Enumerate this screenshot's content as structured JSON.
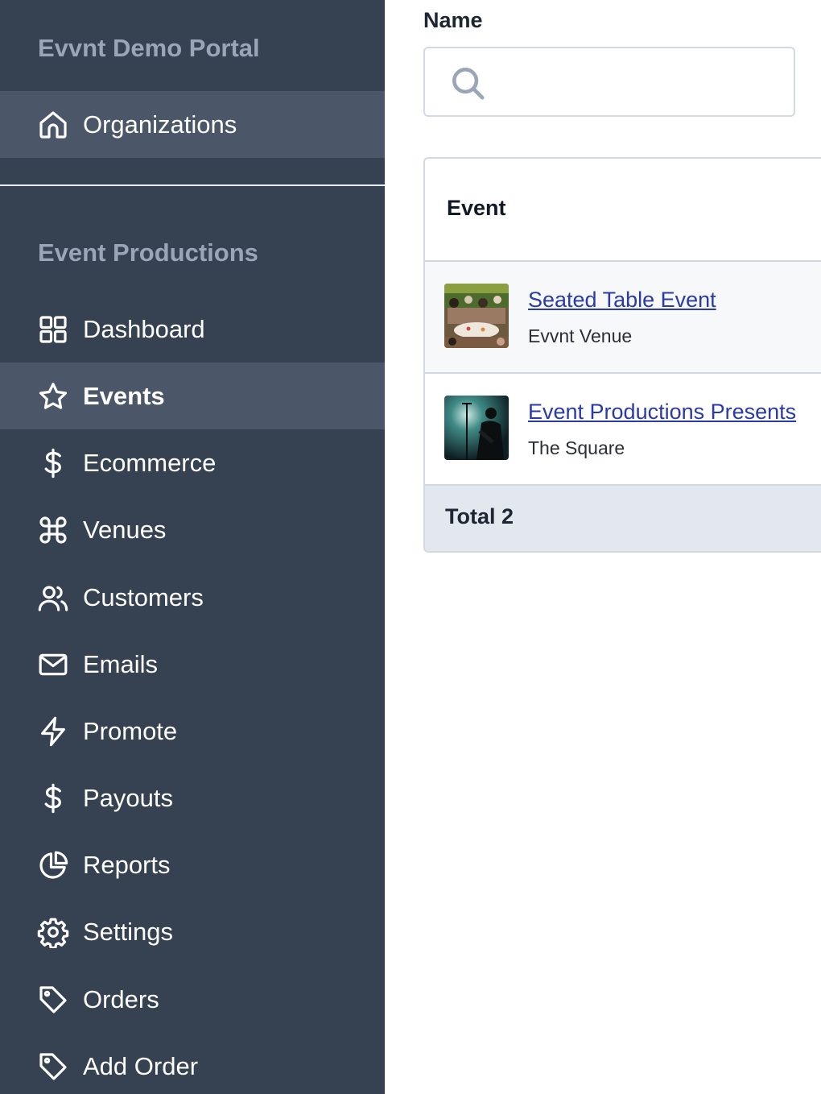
{
  "sidebar": {
    "portal_title": "Evvnt Demo Portal",
    "top_items": [
      {
        "label": "Organizations",
        "icon": "home-icon"
      }
    ],
    "section_title": "Event Productions",
    "items": [
      {
        "label": "Dashboard",
        "icon": "grid-icon"
      },
      {
        "label": "Events",
        "icon": "star-icon"
      },
      {
        "label": "Ecommerce",
        "icon": "dollar-icon"
      },
      {
        "label": "Venues",
        "icon": "command-icon"
      },
      {
        "label": "Customers",
        "icon": "users-icon"
      },
      {
        "label": "Emails",
        "icon": "mail-icon"
      },
      {
        "label": "Promote",
        "icon": "lightning-icon"
      },
      {
        "label": "Payouts",
        "icon": "dollar-icon"
      },
      {
        "label": "Reports",
        "icon": "pie-chart-icon"
      },
      {
        "label": "Settings",
        "icon": "gear-icon"
      },
      {
        "label": "Orders",
        "icon": "tag-icon"
      },
      {
        "label": "Add Order",
        "icon": "tag-icon"
      }
    ],
    "active_item": "Events"
  },
  "filter": {
    "name_label": "Name",
    "search_value": "",
    "search_placeholder": ""
  },
  "table": {
    "column_header": "Event",
    "rows": [
      {
        "title": "Seated Table Event",
        "venue": "Evvnt Venue",
        "thumbnail": "banquet-photo"
      },
      {
        "title": "Event Productions Presents",
        "venue": "The Square",
        "thumbnail": "concert-photo"
      }
    ],
    "footer": "Total 2"
  },
  "colors": {
    "sidebar_bg": "#364152",
    "sidebar_active_bg": "#4b5669",
    "muted_heading": "#9aa5b8",
    "link": "#2a3aa6",
    "table_footer_bg": "#e3e8ef"
  }
}
